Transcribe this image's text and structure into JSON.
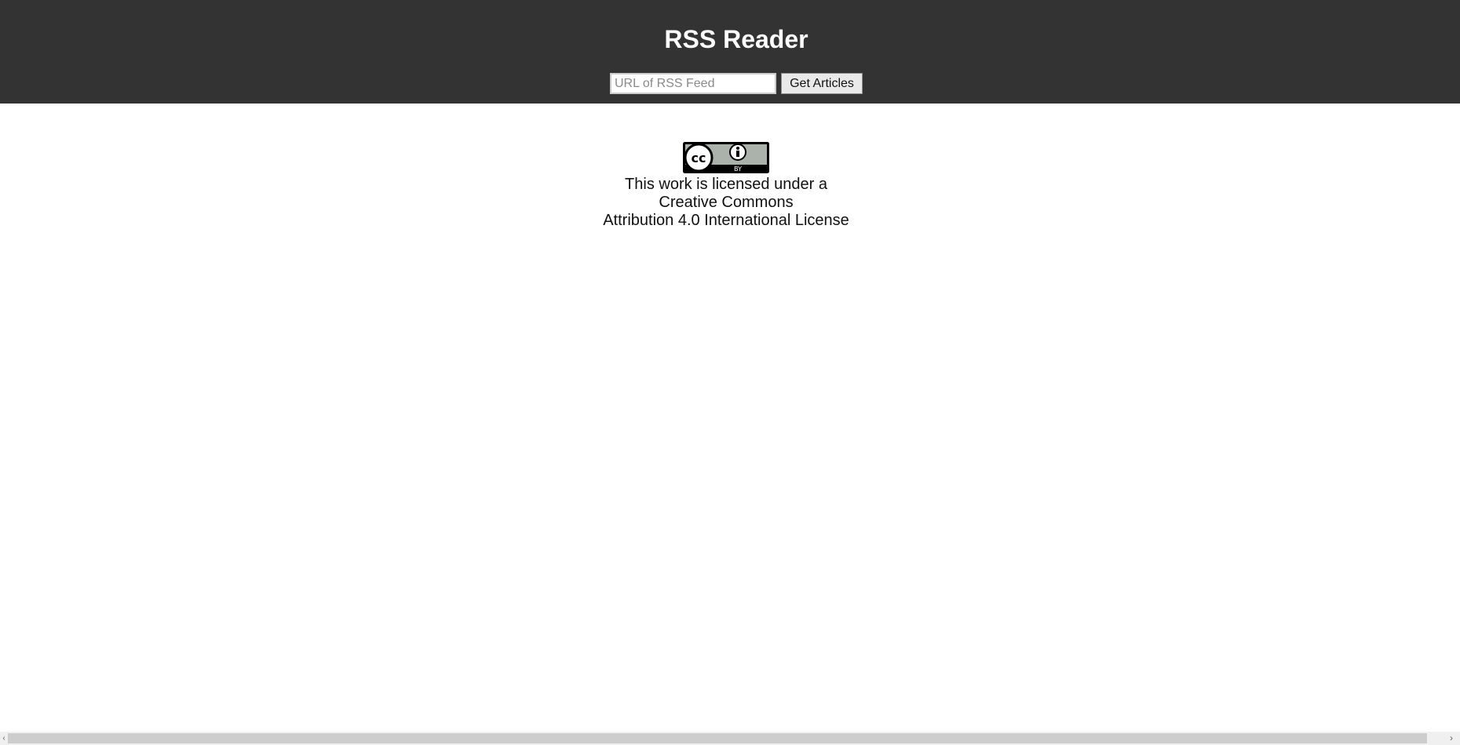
{
  "app": {
    "title": "RSS Reader"
  },
  "search": {
    "placeholder": "URL of RSS Feed",
    "value": "",
    "button_label": "Get Articles"
  },
  "license": {
    "badge_icon": "cc-by-badge-icon",
    "badge_by_label": "BY",
    "lines": [
      "This work is licensed under a",
      "Creative Commons",
      "Attribution 4.0 International License"
    ]
  },
  "scrollbar": {
    "left_arrow": "‹",
    "right_arrow": "›"
  },
  "colors": {
    "header_bg": "#333333",
    "header_text": "#ffffff",
    "page_bg": "#ffffff"
  }
}
